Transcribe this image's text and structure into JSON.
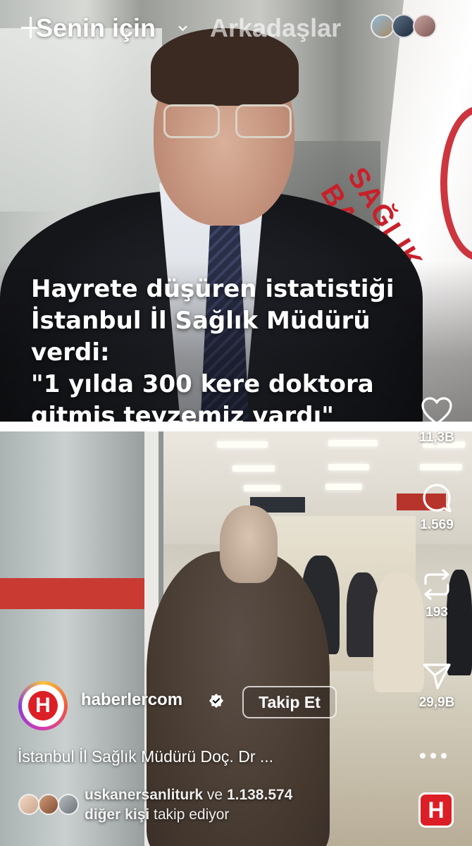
{
  "top_bar": {
    "for_you_tab": "Senin için",
    "friends_tab": "Arkadaşlar"
  },
  "video": {
    "caption": "Hayrete düşüren istatistiği\nİstanbul İl Sağlık Müdürü verdi:\n\"1 yılda 300 kere doktora\ngitmiş teyzemiz vardı\"",
    "flag_text": "SAĞLIK BAK"
  },
  "actions": {
    "like_count": "11,3B",
    "comment_count": "1.569",
    "repost_count": "193",
    "share_count": "29,9B"
  },
  "account": {
    "name": "haberlercom",
    "logo_letter": "H",
    "follow_label": "Takip Et"
  },
  "post": {
    "caption": "İstanbul İl Sağlık Müdürü Doç. Dr ..."
  },
  "followers": {
    "user": "uskanersanliturk",
    "and_text": " ve ",
    "count": "1.138.574",
    "others": "diğer kişi",
    "suffix": " takip ediyor"
  },
  "colors": {
    "brand_red": "#dc1f26",
    "flag_red": "#c8202a"
  },
  "icons": [
    "plus-icon",
    "chevron-down-icon",
    "heart-icon",
    "comment-icon",
    "repost-icon",
    "share-icon",
    "verified-icon",
    "more-icon"
  ]
}
